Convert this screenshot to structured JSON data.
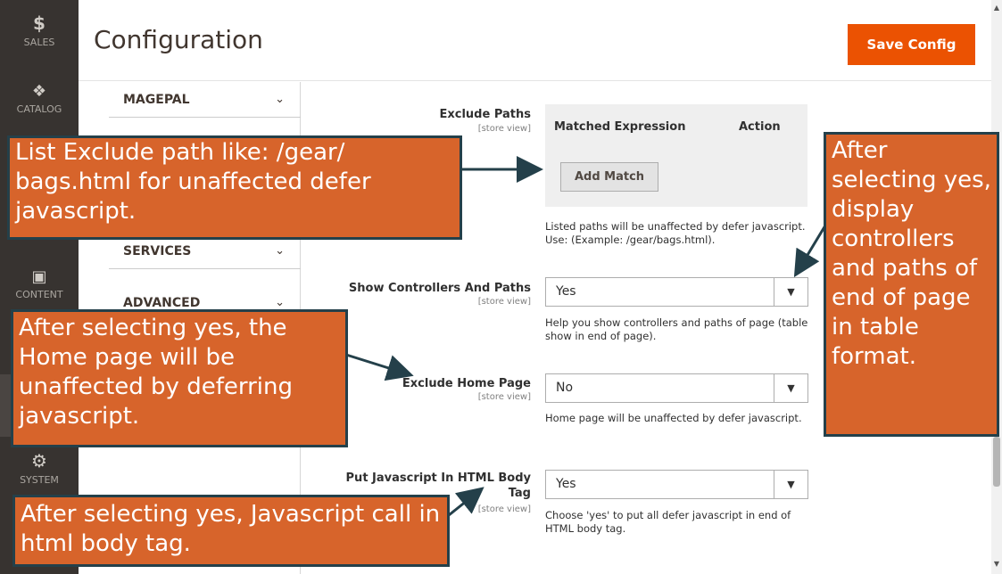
{
  "nav": {
    "items": [
      {
        "label": "SALES",
        "icon": "dollar-icon"
      },
      {
        "label": "CATALOG",
        "icon": "cube-icon"
      },
      {
        "label": "CONTENT",
        "icon": "layout-icon"
      },
      {
        "label": "SYSTEM",
        "icon": "gear-icon"
      }
    ],
    "glyphs": {
      "sales": "$",
      "catalog": "❖",
      "content": "▣",
      "system": "⚙"
    }
  },
  "header": {
    "title": "Configuration",
    "save_label": "Save Config"
  },
  "sections": [
    {
      "label": "MAGEPAL"
    },
    {
      "label": "SERVICES"
    },
    {
      "label": "ADVANCED"
    }
  ],
  "form": {
    "scope": "[store view]",
    "exclude_paths": {
      "label": "Exclude Paths",
      "col_expression": "Matched Expression",
      "col_action": "Action",
      "add_label": "Add Match",
      "note": "Listed paths will be unaffected by defer javascript. Use: (Example: /gear/bags.html)."
    },
    "show_controllers": {
      "label": "Show Controllers And Paths",
      "value": "Yes",
      "note": "Help you show controllers and paths of page (table show in end of page)."
    },
    "exclude_home": {
      "label": "Exclude Home Page",
      "value": "No",
      "note": "Home page will be unaffected by defer javascript."
    },
    "body_tag": {
      "label_line1": "Put Javascript In HTML Body",
      "label_line2": "Tag",
      "value": "Yes",
      "note": "Choose 'yes' to put all defer javascript in end of HTML body tag."
    }
  },
  "callouts": {
    "exclude_path": "List Exclude path like: /gear/ bags.html for unaffected defer javascript.",
    "controllers": "After selecting yes, display controllers and paths of end of page in table format.",
    "home": "After selecting yes, the Home page will be unaffected by deferring javascript.",
    "body": "After selecting yes, Javascript call in html body tag."
  },
  "colors": {
    "accent": "#eb5202",
    "callout": "#d7642b",
    "callout_border": "#24404a",
    "nav": "#373330"
  }
}
